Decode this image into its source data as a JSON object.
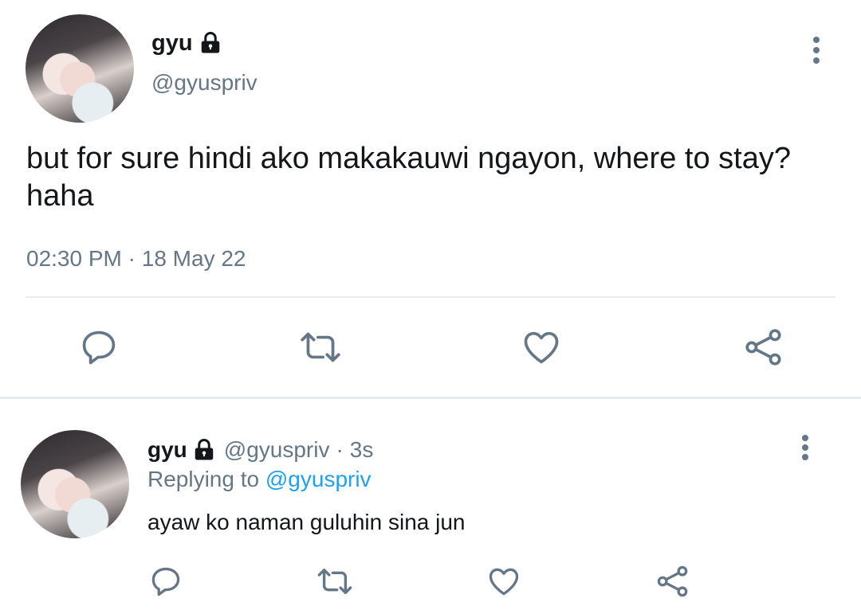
{
  "main_tweet": {
    "display_name": "gyu",
    "handle": "@gyuspriv",
    "text": "but for sure hindi ako makakauwi ngayon, where to stay? haha",
    "time": "02:30 PM",
    "date_sep": "·",
    "date": "18 May 22",
    "icons": [
      "lock-icon",
      "more-options-icon",
      "reply-icon",
      "retweet-icon",
      "like-icon",
      "share-icon"
    ]
  },
  "reply_tweet": {
    "display_name": "gyu",
    "handle": "@gyuspriv",
    "dot": "·",
    "time_ago": "3s",
    "replying_to_label": "Replying to",
    "replying_to_handle": "@gyuspriv",
    "text": "ayaw ko naman guluhin sina jun"
  },
  "colors": {
    "text": "#14171a",
    "muted": "#657786",
    "link": "#1da1f2",
    "divider": "#e6ecf0"
  }
}
